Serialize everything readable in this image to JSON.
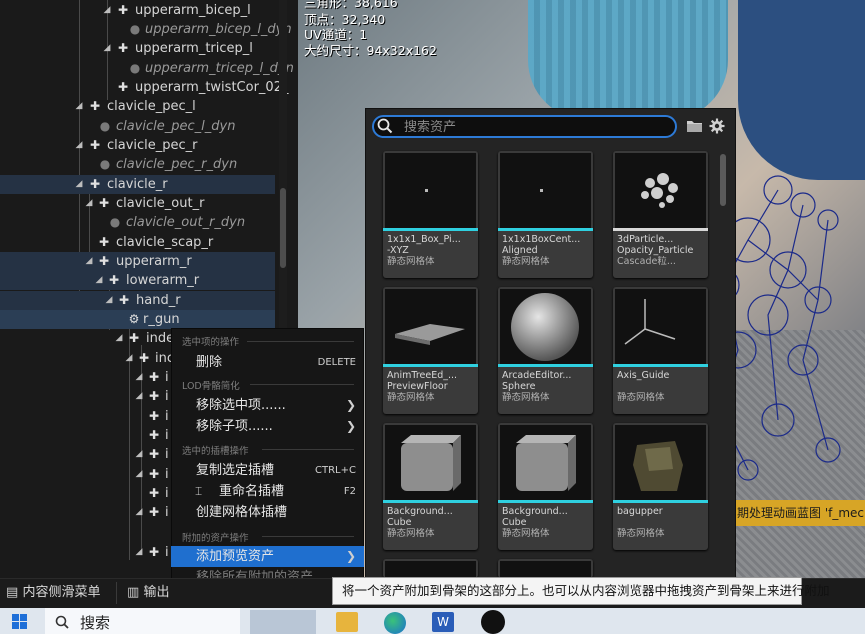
{
  "tree": {
    "rows": [
      {
        "label": "upperarm_bicep_l",
        "kind": "bone"
      },
      {
        "label": "upperarm_bicep_l_dyn",
        "kind": "socket"
      },
      {
        "label": "upperarm_tricep_l",
        "kind": "bone"
      },
      {
        "label": "upperarm_tricep_l_dyn",
        "kind": "socket"
      },
      {
        "label": "upperarm_twistCor_02_",
        "kind": "bone"
      },
      {
        "label": "clavicle_pec_l",
        "kind": "bone"
      },
      {
        "label": "clavicle_pec_l_dyn",
        "kind": "socket"
      },
      {
        "label": "clavicle_pec_r",
        "kind": "bone"
      },
      {
        "label": "clavicle_pec_r_dyn",
        "kind": "socket"
      },
      {
        "label": "clavicle_r",
        "kind": "bone"
      },
      {
        "label": "clavicle_out_r",
        "kind": "bone"
      },
      {
        "label": "clavicle_out_r_dyn",
        "kind": "socket"
      },
      {
        "label": "clavicle_scap_r",
        "kind": "bone"
      },
      {
        "label": "upperarm_r",
        "kind": "bone"
      },
      {
        "label": "lowerarm_r",
        "kind": "bone"
      },
      {
        "label": "hand_r",
        "kind": "bone"
      },
      {
        "label": "r_gun",
        "kind": "mesh-socket"
      },
      {
        "label": "inde",
        "kind": "bone"
      },
      {
        "label": "inc",
        "kind": "bone"
      },
      {
        "label": "i",
        "kind": "bone"
      },
      {
        "label": "i",
        "kind": "bone"
      },
      {
        "label": "i",
        "kind": "bone"
      },
      {
        "label": "i",
        "kind": "bone"
      },
      {
        "label": "i",
        "kind": "bone"
      },
      {
        "label": "i",
        "kind": "bone"
      },
      {
        "label": "i",
        "kind": "bone"
      },
      {
        "label": "i",
        "kind": "bone"
      },
      {
        "label": "i",
        "kind": "bone"
      }
    ]
  },
  "viewport": {
    "stats": [
      {
        "label": "三角形：38,616"
      },
      {
        "label": "顶点：32,340"
      },
      {
        "label": "UV通道：1"
      },
      {
        "label": "大约尺寸：94x32x162"
      }
    ],
    "notice": "期处理动画蓝图 'f_mec"
  },
  "picker": {
    "search_placeholder": "搜索资产",
    "assets": [
      {
        "name1": "1x1x1_Box_Pi...",
        "name2": "-XYZ",
        "type": "静态网格体",
        "thumb": "dot"
      },
      {
        "name1": "1x1x1BoxCent...",
        "name2": "Aligned",
        "type": "静态网格体",
        "thumb": "dot"
      },
      {
        "name1": "3dParticle...",
        "name2": "Opacity_Particle",
        "type": "Cascade粒...",
        "thumb": "particles"
      },
      {
        "name1": "AnimTreeEd_...",
        "name2": "PreviewFloor",
        "type": "静态网格体",
        "thumb": "floor"
      },
      {
        "name1": "ArcadeEditor...",
        "name2": "Sphere",
        "type": "静态网格体",
        "thumb": "sphere"
      },
      {
        "name1": "Axis_Guide",
        "name2": "",
        "type": "静态网格体",
        "thumb": "axis"
      },
      {
        "name1": "Background...",
        "name2": "Cube",
        "type": "静态网格体",
        "thumb": "cube"
      },
      {
        "name1": "Background...",
        "name2": "Cube",
        "type": "静态网格体",
        "thumb": "cube"
      },
      {
        "name1": "bagupper",
        "name2": "",
        "type": "静态网格体",
        "thumb": "bag"
      }
    ]
  },
  "menu": {
    "sections": [
      {
        "header": "选中项的操作"
      },
      {
        "header": "LOD骨骼简化"
      },
      {
        "header": "选中的插槽操作"
      },
      {
        "header": "附加的资产操作"
      }
    ],
    "items": [
      {
        "label": "删除",
        "shortcut": "DELETE"
      },
      {
        "label": "移除选中项......",
        "shortcut": ""
      },
      {
        "label": "移除子项......",
        "shortcut": ""
      },
      {
        "label": "复制选定插槽",
        "shortcut": "CTRL+C"
      },
      {
        "label": "重命名插槽",
        "shortcut": "F2"
      },
      {
        "label": "创建网格体插槽",
        "shortcut": ""
      },
      {
        "label": "添加预览资产",
        "shortcut": ""
      },
      {
        "label": "移除所有附加的资产",
        "shortcut": ""
      }
    ],
    "tooltip": "将一个资产附加到骨架的这部分上。也可以从内容浏览器中拖拽资产到骨架上来进行附加"
  },
  "drawer": {
    "tabs": [
      {
        "label": "内容侧滑菜单"
      },
      {
        "label": "输出"
      }
    ]
  },
  "taskbar": {
    "search_label": "搜索"
  },
  "colors": {
    "accent": "#1f6fcf",
    "asset_bar": "#2fd0e0",
    "notice": "#d7a526",
    "selection": "#2b3e55"
  }
}
